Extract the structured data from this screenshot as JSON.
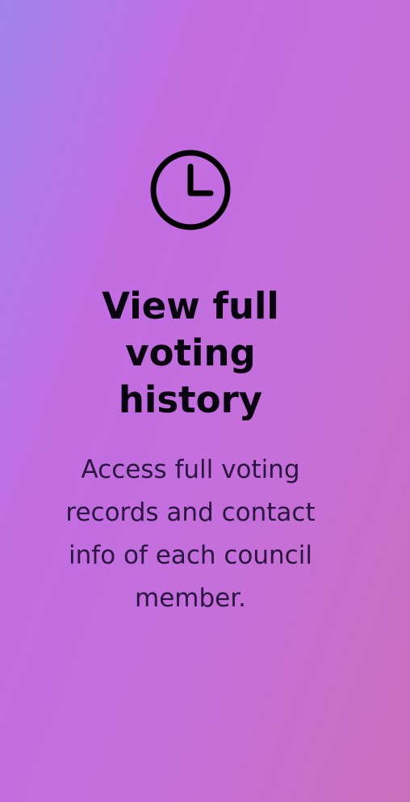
{
  "card": {
    "icon": "clock-icon",
    "title": "View full voting history",
    "description": "Access full voting records and contact info of each council member."
  },
  "colors": {
    "background_start": "#a183ea",
    "background_end": "#cd6fbf",
    "title": "#0a0410",
    "description": "#2a1640"
  }
}
